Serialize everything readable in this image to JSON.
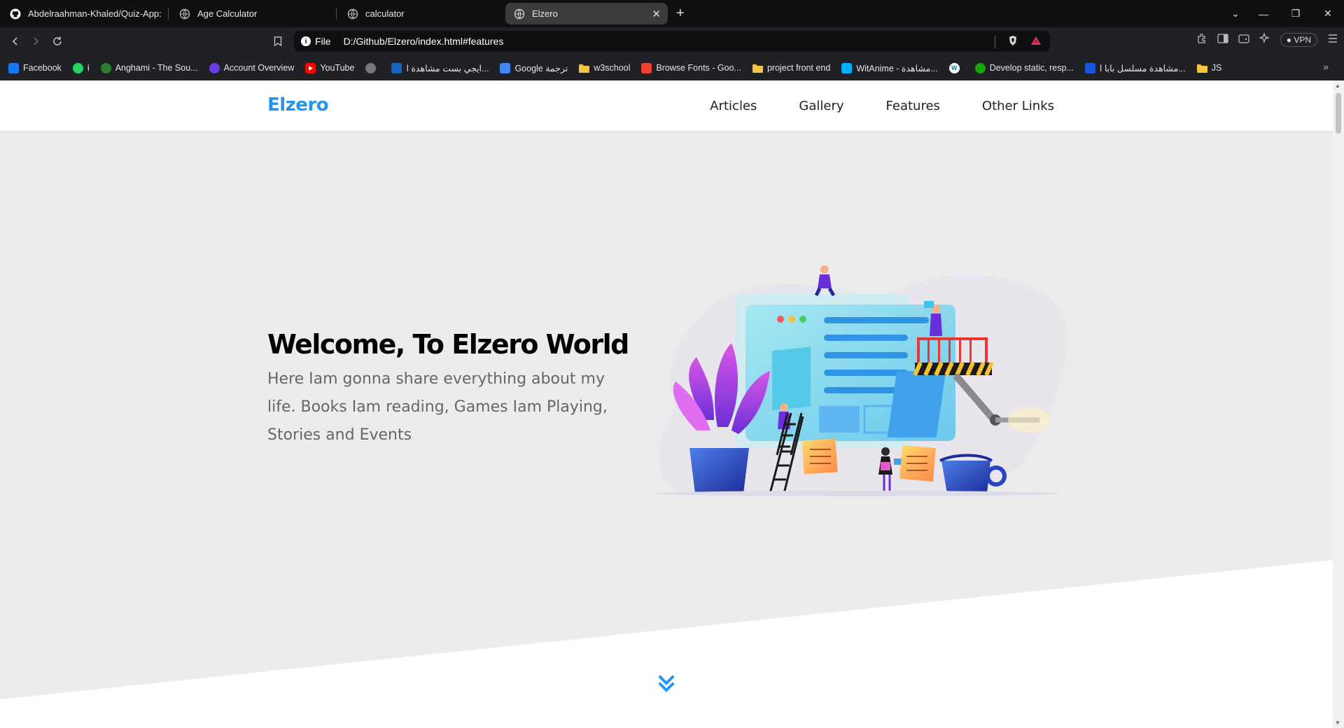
{
  "tabs": [
    {
      "title": "Abdelraahman-Khaled/Quiz-App: Si",
      "icon": "github-icon"
    },
    {
      "title": "Age Calculator",
      "icon": "globe-icon"
    },
    {
      "title": "calculator",
      "icon": "globe-icon"
    },
    {
      "title": "Elzero",
      "icon": "globe-icon",
      "active": true
    }
  ],
  "address": {
    "scheme_label": "File",
    "url": "D:/Github/Elzero/index.html#features"
  },
  "toolbar": {
    "vpn_label": "VPN"
  },
  "bookmarks": [
    {
      "label": "Facebook",
      "icon": "facebook-icon",
      "color": "#1877f2"
    },
    {
      "label": "i",
      "icon": "whatsapp-icon",
      "color": "#25d366"
    },
    {
      "label": "Anghami - The Sou...",
      "icon": "anghami-icon",
      "color": "#2e7d32"
    },
    {
      "label": "Account Overview",
      "icon": "account-icon",
      "color": "#6a3de8"
    },
    {
      "label": "YouTube",
      "icon": "youtube-icon",
      "color": "#ff0000"
    },
    {
      "label": "",
      "icon": "globe-icon",
      "color": "#777777"
    },
    {
      "label": "ايجي بست مشاهدة ا...",
      "icon": "egybest-icon",
      "color": "#1565c0"
    },
    {
      "label": "Google ترجمة",
      "icon": "google-translate-icon",
      "color": "#4285f4"
    },
    {
      "label": "w3school",
      "icon": "folder-icon",
      "color": "#f4c542"
    },
    {
      "label": "Browse Fonts - Goo...",
      "icon": "fonts-icon",
      "color": "#ea4335"
    },
    {
      "label": "project front end",
      "icon": "folder-icon",
      "color": "#f4c542"
    },
    {
      "label": "WitAnime - مشاهدة...",
      "icon": "witanime-icon",
      "color": "#00b0ff"
    },
    {
      "label": "",
      "icon": "wordpress-icon",
      "color": "#ffffff"
    },
    {
      "label": "Develop static, resp...",
      "icon": "upwork-icon",
      "color": "#14a800"
    },
    {
      "label": "مشاهدة مسلسل بابا ا...",
      "icon": "w-icon",
      "color": "#1a56db"
    },
    {
      "label": "JS",
      "icon": "folder-icon",
      "color": "#f4c542"
    }
  ],
  "site": {
    "logo": "Elzero",
    "nav": [
      "Articles",
      "Gallery",
      "Features",
      "Other Links"
    ],
    "hero_title": "Welcome, To Elzero World",
    "hero_text": "Here Iam gonna share everything about my life. Books Iam reading, Games Iam Playing, Stories and Events"
  },
  "colors": {
    "accent": "#2196f3",
    "hero_bg": "#ececec",
    "browser_dark": "#0f1011"
  }
}
